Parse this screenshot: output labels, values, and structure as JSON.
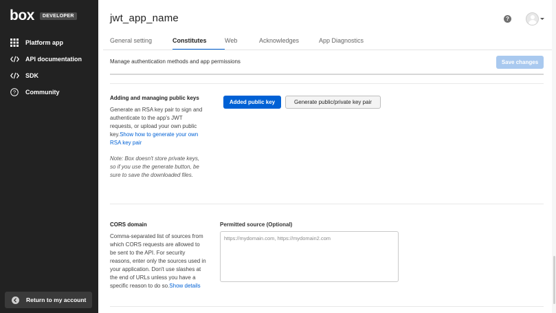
{
  "sidebar": {
    "logo": "box",
    "badge": "DEVELOPER",
    "items": [
      {
        "label": "Platform app",
        "icon": "grid-icon"
      },
      {
        "label": "API documentation",
        "icon": "code-icon"
      },
      {
        "label": "SDK",
        "icon": "code-icon"
      },
      {
        "label": "Community",
        "icon": "help-icon"
      }
    ],
    "return_label": "Return to my account"
  },
  "header": {
    "title": "jwt_app_name",
    "help_glyph": "?"
  },
  "tabs": [
    {
      "label": "General setting",
      "active": false
    },
    {
      "label": "Constitutes",
      "active": true
    },
    {
      "label": "Web",
      "active": false
    },
    {
      "label": "Acknowledges",
      "active": false
    },
    {
      "label": "App Diagnostics",
      "active": false
    }
  ],
  "main": {
    "subtitle": "Manage authentication methods and app permissions",
    "save_label": "Save changes",
    "public_keys": {
      "title": "Adding and managing public keys",
      "desc": "Generate an RSA key pair to sign and authenticate to the app's JWT requests, or upload your own public key.",
      "link": "Show how to generate your own RSA key pair",
      "note": "Note: Box doesn't store private keys, so if you use the generate button, be sure to save the downloaded files.",
      "add_button": "Added public key",
      "generate_button": "Generate public/private key pair"
    },
    "cors": {
      "title": "CORS domain",
      "desc": "Comma-separated list of sources from which CORS requests are allowed to be sent to the API. For security reasons, enter only the sources used in your application. Don't use slashes at the end of URLs unless you have a specific reason to do so.",
      "link": "Show details",
      "field_label": "Permitted source (Optional)",
      "placeholder": "https://mydomain.com, https://mydomain2.com",
      "value": ""
    }
  },
  "colors": {
    "sidebar_bg": "#222222",
    "accent": "#0061d5",
    "save_disabled": "#a9c9ef"
  }
}
